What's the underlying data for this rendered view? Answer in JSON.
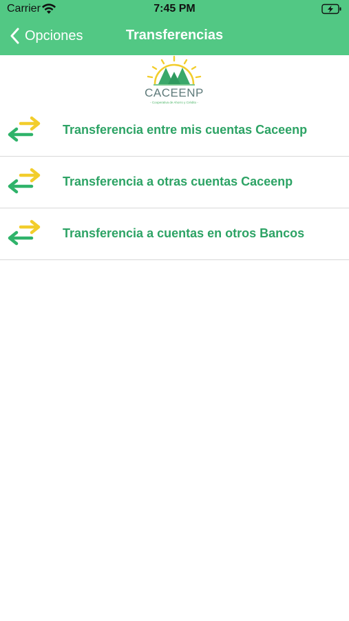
{
  "status_bar": {
    "carrier": "Carrier",
    "time": "7:45 PM"
  },
  "nav": {
    "back_label": "Opciones",
    "title": "Transferencias"
  },
  "logo": {
    "name": "CACEENP",
    "subtitle": "- Cooperativa de Ahorro y Crédito -"
  },
  "menu": {
    "items": [
      {
        "label": "Transferencia entre mis cuentas Caceenp",
        "icon": "transfer-arrows-icon"
      },
      {
        "label": "Transferencia a otras cuentas Caceenp",
        "icon": "transfer-arrows-icon"
      },
      {
        "label": "Transferencia a cuentas en otros Bancos",
        "icon": "transfer-arrows-icon"
      }
    ]
  },
  "colors": {
    "header_green": "#52c884",
    "text_green": "#2da365",
    "arrow_yellow": "#f2cd2c",
    "arrow_green": "#2fb36a"
  }
}
